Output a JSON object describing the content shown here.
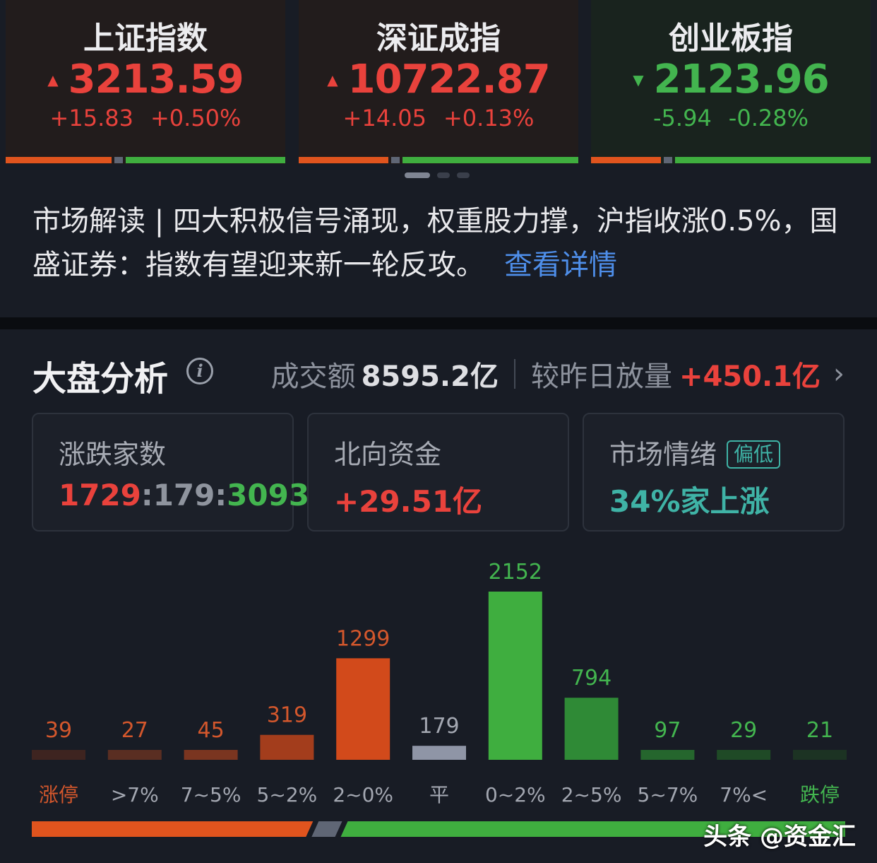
{
  "indices": [
    {
      "name": "上证指数",
      "value": "3213.59",
      "change": "+15.83",
      "pct": "+0.50%",
      "direction": "up",
      "arrow": "▲",
      "up_ratio": 0.38,
      "flat_ratio": 0.04
    },
    {
      "name": "深证成指",
      "value": "10722.87",
      "change": "+14.05",
      "pct": "+0.13%",
      "direction": "up",
      "arrow": "▲",
      "up_ratio": 0.32,
      "flat_ratio": 0.04
    },
    {
      "name": "创业板指",
      "value": "2123.96",
      "change": "-5.94",
      "pct": "-0.28%",
      "direction": "down",
      "arrow": "▼",
      "up_ratio": 0.25,
      "flat_ratio": 0.04
    }
  ],
  "pager": {
    "count": 3,
    "active": 0
  },
  "news": {
    "text": "市场解读 | 四大积极信号涌现，权重股力撑，沪指收涨0.5%，国盛证券：指数有望迎来新一轮反攻。",
    "link": "查看详情"
  },
  "analysis": {
    "title": "大盘分析",
    "info_icon": "i",
    "turnover_label": "成交额",
    "turnover_value": "8595.2亿",
    "compare_label": "较昨日放量",
    "compare_value": "+450.1亿",
    "chevron": "›"
  },
  "stats": {
    "breadth": {
      "label": "涨跌家数",
      "up": "1729",
      "flat": "179",
      "down": "3093",
      "sep": ":"
    },
    "northbound": {
      "label": "北向资金",
      "value": "+29.51亿"
    },
    "sentiment": {
      "label": "市场情绪",
      "badge": "偏低",
      "value": "34%家上涨"
    }
  },
  "colors": {
    "up": "#e9423c",
    "down": "#43b54f",
    "flat": "#8f949e",
    "accent": "#4e8ee9"
  },
  "chart_data": {
    "type": "bar",
    "categories": [
      "涨停",
      ">7%",
      "7~5%",
      "5~2%",
      "2~0%",
      "平",
      "0~2%",
      "2~5%",
      "5~7%",
      "7%<",
      "跌停"
    ],
    "values": [
      39,
      27,
      45,
      319,
      1299,
      179,
      2152,
      794,
      97,
      29,
      21
    ],
    "bar_colors": [
      "#3e2420",
      "#5a2e22",
      "#7a3520",
      "#a33d1c",
      "#d24a1b",
      "#8f95a6",
      "#3fae3f",
      "#2f8a36",
      "#25662d",
      "#1f4a26",
      "#1c3323"
    ],
    "label_colors": [
      "#d3572c",
      "#d3572c",
      "#d3572c",
      "#d3572c",
      "#d3572c",
      "#a3a7b1",
      "#43b54f",
      "#43b54f",
      "#43b54f",
      "#43b54f",
      "#43b54f"
    ],
    "category_colors": [
      "#d3572c",
      "#a3a7b1",
      "#a3a7b1",
      "#a3a7b1",
      "#a3a7b1",
      "#a3a7b1",
      "#a3a7b1",
      "#a3a7b1",
      "#a3a7b1",
      "#a3a7b1",
      "#43b54f"
    ],
    "ylim": [
      0,
      2152
    ],
    "ratio_bar": {
      "up": 1729,
      "flat": 179,
      "down": 3093
    }
  },
  "watermark": "头条 @资金汇"
}
